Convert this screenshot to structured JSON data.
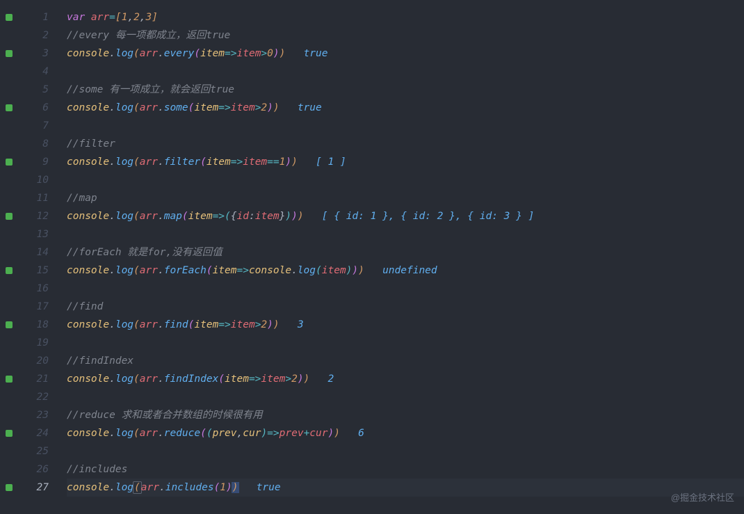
{
  "watermark": "@掘金技术社区",
  "current_line": 27,
  "lines": [
    {
      "n": 1,
      "marker": true,
      "kind": "code",
      "tokens": [
        {
          "t": "var ",
          "c": "kw"
        },
        {
          "t": "arr",
          "c": "var"
        },
        {
          "t": "=",
          "c": "op"
        },
        {
          "t": "[",
          "c": "paren1"
        },
        {
          "t": "1",
          "c": "num"
        },
        {
          "t": ",",
          "c": "punc"
        },
        {
          "t": "2",
          "c": "num"
        },
        {
          "t": ",",
          "c": "punc"
        },
        {
          "t": "3",
          "c": "num"
        },
        {
          "t": "]",
          "c": "paren1"
        }
      ]
    },
    {
      "n": 2,
      "marker": false,
      "kind": "comment",
      "text": "//every 每一项都成立，返回true"
    },
    {
      "n": 3,
      "marker": true,
      "kind": "code",
      "tokens": [
        {
          "t": "console",
          "c": "prop"
        },
        {
          "t": ".",
          "c": "punc"
        },
        {
          "t": "log",
          "c": "fn"
        },
        {
          "t": "(",
          "c": "paren1"
        },
        {
          "t": "arr",
          "c": "var"
        },
        {
          "t": ".",
          "c": "punc"
        },
        {
          "t": "every",
          "c": "fn"
        },
        {
          "t": "(",
          "c": "paren2"
        },
        {
          "t": "item",
          "c": "param"
        },
        {
          "t": "=>",
          "c": "op"
        },
        {
          "t": "item",
          "c": "var"
        },
        {
          "t": ">",
          "c": "op"
        },
        {
          "t": "0",
          "c": "num"
        },
        {
          "t": ")",
          "c": "paren2"
        },
        {
          "t": ")",
          "c": "paren1"
        },
        {
          "t": "   ",
          "c": ""
        },
        {
          "t": "true",
          "c": "result"
        }
      ]
    },
    {
      "n": 4,
      "marker": false,
      "kind": "blank"
    },
    {
      "n": 5,
      "marker": false,
      "kind": "comment",
      "text": "//some 有一项成立，就会返回true"
    },
    {
      "n": 6,
      "marker": true,
      "kind": "code",
      "tokens": [
        {
          "t": "console",
          "c": "prop"
        },
        {
          "t": ".",
          "c": "punc"
        },
        {
          "t": "log",
          "c": "fn"
        },
        {
          "t": "(",
          "c": "paren1"
        },
        {
          "t": "arr",
          "c": "var"
        },
        {
          "t": ".",
          "c": "punc"
        },
        {
          "t": "some",
          "c": "fn"
        },
        {
          "t": "(",
          "c": "paren2"
        },
        {
          "t": "item",
          "c": "param"
        },
        {
          "t": "=>",
          "c": "op"
        },
        {
          "t": "item",
          "c": "var"
        },
        {
          "t": ">",
          "c": "op"
        },
        {
          "t": "2",
          "c": "num"
        },
        {
          "t": ")",
          "c": "paren2"
        },
        {
          "t": ")",
          "c": "paren1"
        },
        {
          "t": "   ",
          "c": ""
        },
        {
          "t": "true",
          "c": "result"
        }
      ]
    },
    {
      "n": 7,
      "marker": false,
      "kind": "blank"
    },
    {
      "n": 8,
      "marker": false,
      "kind": "comment",
      "text": "//filter"
    },
    {
      "n": 9,
      "marker": true,
      "kind": "code",
      "tokens": [
        {
          "t": "console",
          "c": "prop"
        },
        {
          "t": ".",
          "c": "punc"
        },
        {
          "t": "log",
          "c": "fn"
        },
        {
          "t": "(",
          "c": "paren1"
        },
        {
          "t": "arr",
          "c": "var"
        },
        {
          "t": ".",
          "c": "punc"
        },
        {
          "t": "filter",
          "c": "fn"
        },
        {
          "t": "(",
          "c": "paren2"
        },
        {
          "t": "item",
          "c": "param"
        },
        {
          "t": "=>",
          "c": "op"
        },
        {
          "t": "item",
          "c": "var"
        },
        {
          "t": "==",
          "c": "op"
        },
        {
          "t": "1",
          "c": "num"
        },
        {
          "t": ")",
          "c": "paren2"
        },
        {
          "t": ")",
          "c": "paren1"
        },
        {
          "t": "   ",
          "c": ""
        },
        {
          "t": "[ 1 ]",
          "c": "result"
        }
      ]
    },
    {
      "n": 10,
      "marker": false,
      "kind": "blank"
    },
    {
      "n": 11,
      "marker": false,
      "kind": "comment",
      "text": "//map"
    },
    {
      "n": 12,
      "marker": true,
      "kind": "code",
      "tokens": [
        {
          "t": "console",
          "c": "prop"
        },
        {
          "t": ".",
          "c": "punc"
        },
        {
          "t": "log",
          "c": "fn"
        },
        {
          "t": "(",
          "c": "paren1"
        },
        {
          "t": "arr",
          "c": "var"
        },
        {
          "t": ".",
          "c": "punc"
        },
        {
          "t": "map",
          "c": "fn"
        },
        {
          "t": "(",
          "c": "paren2"
        },
        {
          "t": "item",
          "c": "param"
        },
        {
          "t": "=>",
          "c": "op"
        },
        {
          "t": "(",
          "c": "paren3"
        },
        {
          "t": "{",
          "c": "brace"
        },
        {
          "t": "id",
          "c": "var"
        },
        {
          "t": ":",
          "c": "punc"
        },
        {
          "t": "item",
          "c": "var"
        },
        {
          "t": "}",
          "c": "brace"
        },
        {
          "t": ")",
          "c": "paren3"
        },
        {
          "t": ")",
          "c": "paren2"
        },
        {
          "t": ")",
          "c": "paren1"
        },
        {
          "t": "   ",
          "c": ""
        },
        {
          "t": "[ { id: 1 }, { id: 2 }, { id: 3 } ]",
          "c": "result"
        }
      ]
    },
    {
      "n": 13,
      "marker": false,
      "kind": "blank"
    },
    {
      "n": 14,
      "marker": false,
      "kind": "comment",
      "text": "//forEach 就是for,没有返回值"
    },
    {
      "n": 15,
      "marker": true,
      "kind": "code",
      "tokens": [
        {
          "t": "console",
          "c": "prop"
        },
        {
          "t": ".",
          "c": "punc"
        },
        {
          "t": "log",
          "c": "fn"
        },
        {
          "t": "(",
          "c": "paren1"
        },
        {
          "t": "arr",
          "c": "var"
        },
        {
          "t": ".",
          "c": "punc"
        },
        {
          "t": "forEach",
          "c": "fn"
        },
        {
          "t": "(",
          "c": "paren2"
        },
        {
          "t": "item",
          "c": "param"
        },
        {
          "t": "=>",
          "c": "op"
        },
        {
          "t": "console",
          "c": "prop"
        },
        {
          "t": ".",
          "c": "punc"
        },
        {
          "t": "log",
          "c": "fn"
        },
        {
          "t": "(",
          "c": "paren3"
        },
        {
          "t": "item",
          "c": "var"
        },
        {
          "t": ")",
          "c": "paren3"
        },
        {
          "t": ")",
          "c": "paren2"
        },
        {
          "t": ")",
          "c": "paren1"
        },
        {
          "t": "   ",
          "c": ""
        },
        {
          "t": "undefined",
          "c": "result"
        }
      ]
    },
    {
      "n": 16,
      "marker": false,
      "kind": "blank"
    },
    {
      "n": 17,
      "marker": false,
      "kind": "comment",
      "text": "//find"
    },
    {
      "n": 18,
      "marker": true,
      "kind": "code",
      "tokens": [
        {
          "t": "console",
          "c": "prop"
        },
        {
          "t": ".",
          "c": "punc"
        },
        {
          "t": "log",
          "c": "fn"
        },
        {
          "t": "(",
          "c": "paren1"
        },
        {
          "t": "arr",
          "c": "var"
        },
        {
          "t": ".",
          "c": "punc"
        },
        {
          "t": "find",
          "c": "fn"
        },
        {
          "t": "(",
          "c": "paren2"
        },
        {
          "t": "item",
          "c": "param"
        },
        {
          "t": "=>",
          "c": "op"
        },
        {
          "t": "item",
          "c": "var"
        },
        {
          "t": ">",
          "c": "op"
        },
        {
          "t": "2",
          "c": "num"
        },
        {
          "t": ")",
          "c": "paren2"
        },
        {
          "t": ")",
          "c": "paren1"
        },
        {
          "t": "   ",
          "c": ""
        },
        {
          "t": "3",
          "c": "result"
        }
      ]
    },
    {
      "n": 19,
      "marker": false,
      "kind": "blank"
    },
    {
      "n": 20,
      "marker": false,
      "kind": "comment",
      "text": "//findIndex"
    },
    {
      "n": 21,
      "marker": true,
      "kind": "code",
      "tokens": [
        {
          "t": "console",
          "c": "prop"
        },
        {
          "t": ".",
          "c": "punc"
        },
        {
          "t": "log",
          "c": "fn"
        },
        {
          "t": "(",
          "c": "paren1"
        },
        {
          "t": "arr",
          "c": "var"
        },
        {
          "t": ".",
          "c": "punc"
        },
        {
          "t": "findIndex",
          "c": "fn"
        },
        {
          "t": "(",
          "c": "paren2"
        },
        {
          "t": "item",
          "c": "param"
        },
        {
          "t": "=>",
          "c": "op"
        },
        {
          "t": "item",
          "c": "var"
        },
        {
          "t": ">",
          "c": "op"
        },
        {
          "t": "2",
          "c": "num"
        },
        {
          "t": ")",
          "c": "paren2"
        },
        {
          "t": ")",
          "c": "paren1"
        },
        {
          "t": "   ",
          "c": ""
        },
        {
          "t": "2",
          "c": "result"
        }
      ]
    },
    {
      "n": 22,
      "marker": false,
      "kind": "blank"
    },
    {
      "n": 23,
      "marker": false,
      "kind": "comment",
      "text": "//reduce 求和或者合并数组的时候很有用"
    },
    {
      "n": 24,
      "marker": true,
      "kind": "code",
      "tokens": [
        {
          "t": "console",
          "c": "prop"
        },
        {
          "t": ".",
          "c": "punc"
        },
        {
          "t": "log",
          "c": "fn"
        },
        {
          "t": "(",
          "c": "paren1"
        },
        {
          "t": "arr",
          "c": "var"
        },
        {
          "t": ".",
          "c": "punc"
        },
        {
          "t": "reduce",
          "c": "fn"
        },
        {
          "t": "(",
          "c": "paren2"
        },
        {
          "t": "(",
          "c": "paren3"
        },
        {
          "t": "prev",
          "c": "param"
        },
        {
          "t": ",",
          "c": "punc"
        },
        {
          "t": "cur",
          "c": "param"
        },
        {
          "t": ")",
          "c": "paren3"
        },
        {
          "t": "=>",
          "c": "op"
        },
        {
          "t": "prev",
          "c": "var"
        },
        {
          "t": "+",
          "c": "op"
        },
        {
          "t": "cur",
          "c": "var"
        },
        {
          "t": ")",
          "c": "paren2"
        },
        {
          "t": ")",
          "c": "paren1"
        },
        {
          "t": "   ",
          "c": ""
        },
        {
          "t": "6",
          "c": "result"
        }
      ]
    },
    {
      "n": 25,
      "marker": false,
      "kind": "blank"
    },
    {
      "n": 26,
      "marker": false,
      "kind": "comment",
      "text": "//includes"
    },
    {
      "n": 27,
      "marker": true,
      "kind": "code",
      "current": true,
      "tokens": [
        {
          "t": "console",
          "c": "prop"
        },
        {
          "t": ".",
          "c": "punc"
        },
        {
          "t": "log",
          "c": "fn"
        },
        {
          "t": "(",
          "c": "paren1 bracket-hl"
        },
        {
          "t": "arr",
          "c": "var"
        },
        {
          "t": ".",
          "c": "punc"
        },
        {
          "t": "includes",
          "c": "fn"
        },
        {
          "t": "(",
          "c": "paren2"
        },
        {
          "t": "1",
          "c": "num"
        },
        {
          "t": ")",
          "c": "paren2"
        },
        {
          "t": ")",
          "c": "paren1 cursor-cell"
        },
        {
          "t": "   ",
          "c": ""
        },
        {
          "t": "true",
          "c": "result"
        }
      ]
    }
  ]
}
